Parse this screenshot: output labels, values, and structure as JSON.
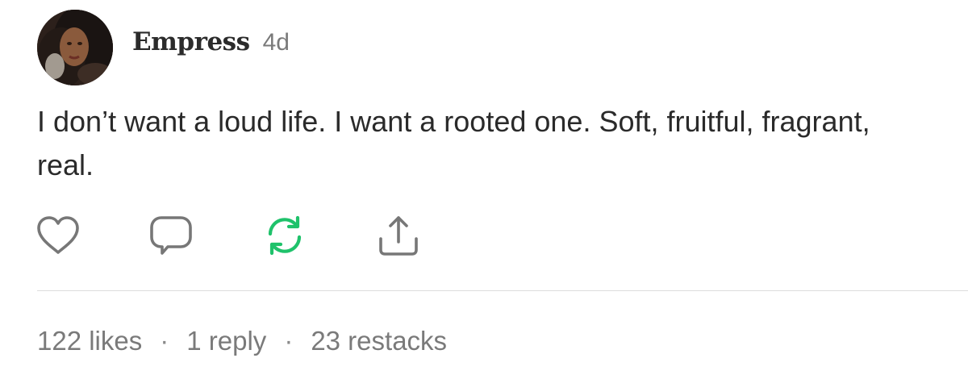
{
  "post": {
    "author": "Empress",
    "age": "4d",
    "text": "I don’t want a loud life. I want a rooted one. Soft, fruitful, fragrant, real."
  },
  "actions": [
    {
      "name": "like",
      "icon": "heart-icon"
    },
    {
      "name": "comment",
      "icon": "comment-icon"
    },
    {
      "name": "restack",
      "icon": "restack-icon",
      "color": "#1fc26b"
    },
    {
      "name": "share",
      "icon": "share-icon"
    }
  ],
  "stats": {
    "likes": "122 likes",
    "replies": "1 reply",
    "restacks": "23 restacks",
    "separator": "·"
  },
  "colors": {
    "text": "#2a2a2a",
    "muted": "#7a7a7a",
    "icon": "#777777",
    "accent": "#1fc26b",
    "divider": "#dddddd"
  }
}
